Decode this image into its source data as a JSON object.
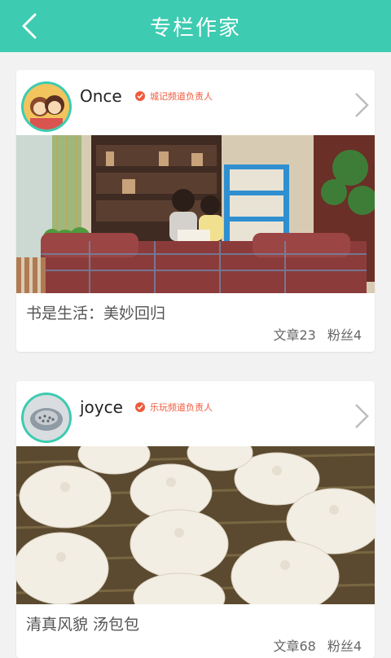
{
  "header": {
    "title": "专栏作家",
    "back_icon": "back-chevron-icon"
  },
  "cards": [
    {
      "name": "Once",
      "badge": "城记频道负责人",
      "caption": "书是生活：美妙回归",
      "stats_articles": "文章23",
      "stats_fans": "粉丝4",
      "image": "photo-reading-room"
    },
    {
      "name": "joyce",
      "badge": "乐玩频道负责人",
      "caption": "清真风貌 汤包包",
      "stats_articles": "文章68",
      "stats_fans": "粉丝4",
      "image": "photo-soup-dumplings"
    }
  ],
  "colors": {
    "accent": "#3dcbb1",
    "badge": "#f05a3c"
  }
}
